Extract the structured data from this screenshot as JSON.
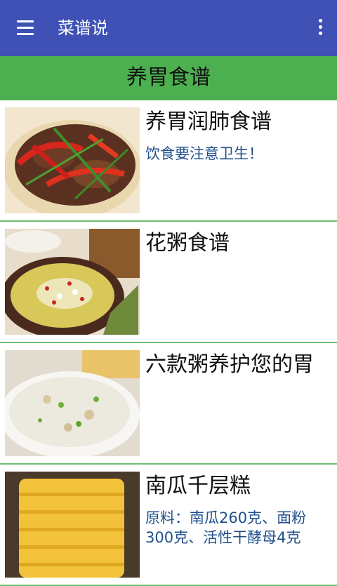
{
  "app_bar": {
    "title": "菜谱说",
    "menu_icon": "menu-icon",
    "overflow_icon": "more-vert-icon",
    "color": "#3F51B5"
  },
  "section": {
    "title": "养胃食谱",
    "color": "#4CAF50"
  },
  "recipes": [
    {
      "title": "养胃润肺食谱",
      "description": "饮食要注意卫生！"
    },
    {
      "title": "花粥食谱",
      "description": ""
    },
    {
      "title": "六款粥养护您的胃",
      "description": ""
    },
    {
      "title": "南瓜千层糕",
      "description": "原料：南瓜260克、面粉300克、活性干酵母4克"
    }
  ]
}
